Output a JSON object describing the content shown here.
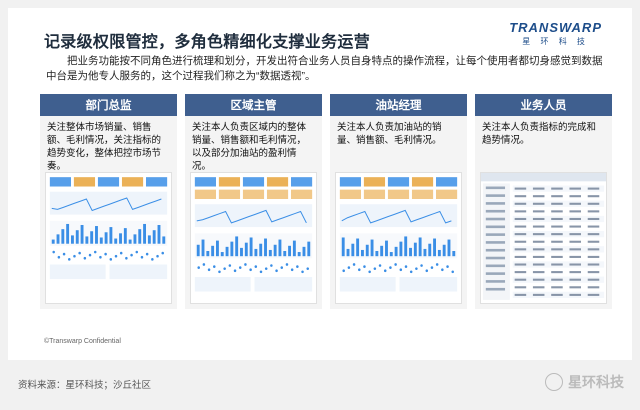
{
  "slide": {
    "title": "记录级权限管控，多角色精细化支撑业务运营",
    "logo_text": "TRANSWARP",
    "logo_subtitle": "星 环 科 技",
    "intro": "把业务功能按不同角色进行梳理和划分，开发出符合业务人员自身特点的操作流程，让每个使用者都切身感觉到数据中台是为他专人服务的，这个过程我们称之为“数据透视”。",
    "copyright": "©Transwarp Confidential"
  },
  "cards": [
    {
      "title": "部门总监",
      "desc": "关注整体市场销量、销售额、毛利情况，关注指标的趋势变化，整体把控市场节奏。"
    },
    {
      "title": "区域主管",
      "desc": "关注本人负责区域内的整体销量、销售额和毛利情况，以及部分加油站的盈利情况。"
    },
    {
      "title": "油站经理",
      "desc": "关注本人负责加油站的销量、销售额、毛利情况。"
    },
    {
      "title": "业务人员",
      "desc": "关注本人负责指标的完成和趋势情况。"
    }
  ],
  "footer": {
    "source": "资料来源：星环科技；沙丘社区",
    "watermark": "星环科技"
  },
  "colors": {
    "card_header": "#3f5f8f",
    "accent_blue": "#3a8ee6",
    "accent_orange": "#e8a33a",
    "title": "#1f2d3d"
  }
}
